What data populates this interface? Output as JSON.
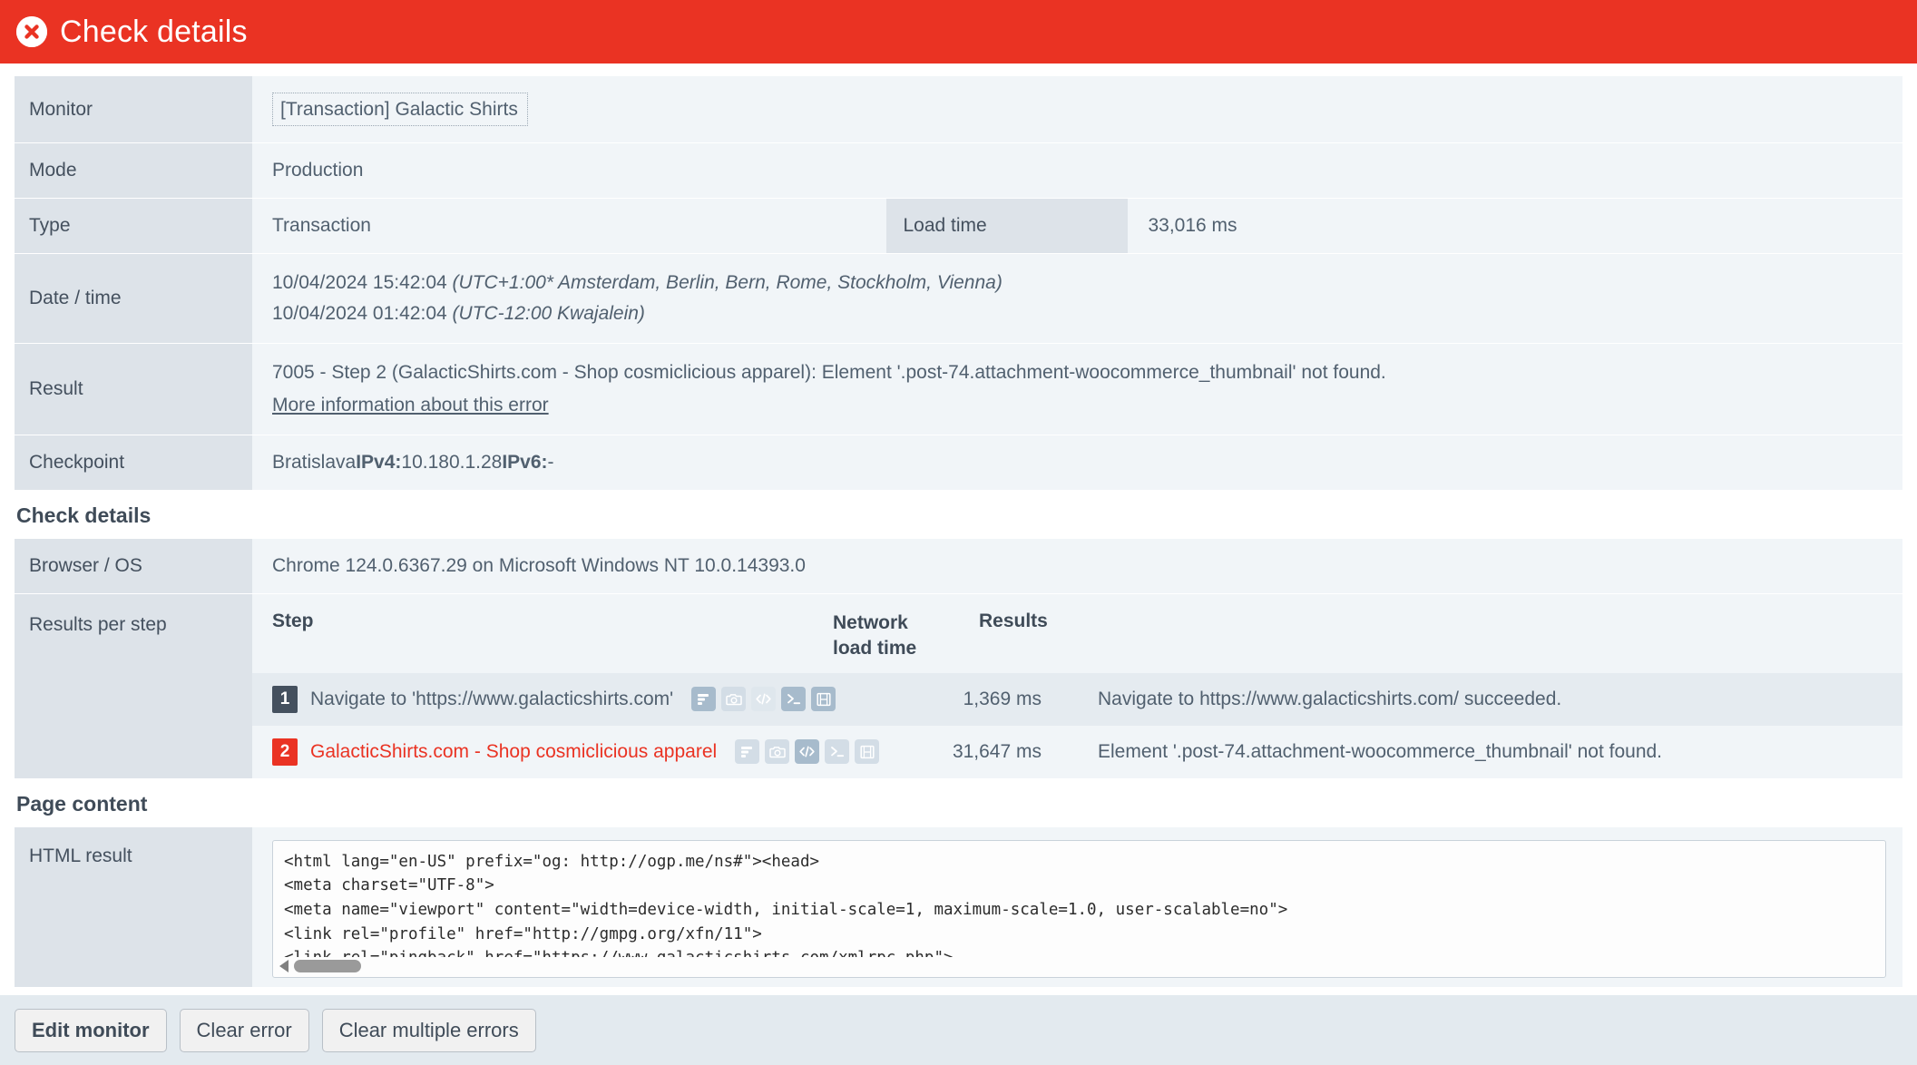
{
  "header": {
    "title": "Check details",
    "icon": "error-circle-x-icon",
    "bg_color": "#ea3323"
  },
  "details": {
    "monitor": {
      "label": "Monitor",
      "value": "[Transaction] Galactic Shirts"
    },
    "mode": {
      "label": "Mode",
      "value": "Production"
    },
    "type": {
      "label": "Type",
      "value": "Transaction"
    },
    "load_time": {
      "label": "Load time",
      "value": "33,016 ms"
    },
    "datetime": {
      "label": "Date / time",
      "line1_date": "10/04/2024 15:42:04 ",
      "line1_tz": "(UTC+1:00* Amsterdam, Berlin, Bern, Rome, Stockholm, Vienna)",
      "line2_date": "10/04/2024 01:42:04 ",
      "line2_tz": "(UTC-12:00 Kwajalein)"
    },
    "result": {
      "label": "Result",
      "message": "7005 - Step 2 (GalacticShirts.com - Shop cosmiclicious apparel): Element '.post-74.attachment-woocommerce_thumbnail' not found.",
      "link": "More information about this error"
    },
    "checkpoint": {
      "label": "Checkpoint",
      "city": "Bratislava ",
      "ipv4_label": "IPv4:",
      "ipv4": " 10.180.1.28 ",
      "ipv6_label": "IPv6:",
      "ipv6": " -"
    }
  },
  "check_details": {
    "heading": "Check details",
    "browser_os": {
      "label": "Browser / OS",
      "value": "Chrome 124.0.6367.29 on Microsoft Windows NT 10.0.14393.0"
    },
    "results_per_step": {
      "label": "Results per step",
      "columns": {
        "step": "Step",
        "network_load_time_l1": "Network",
        "network_load_time_l2": "load time",
        "results": "Results"
      },
      "rows": [
        {
          "number": "1",
          "state": "ok",
          "text": "Navigate to 'https://www.galacticshirts.com'",
          "network_load_time": "1,369 ms",
          "result": "Navigate to https://www.galacticshirts.com/ succeeded.",
          "icons": [
            "waterfall-icon",
            "camera-icon",
            "code-icon",
            "console-icon",
            "filmstrip-icon"
          ]
        },
        {
          "number": "2",
          "state": "error",
          "text": "GalacticShirts.com - Shop cosmiclicious apparel",
          "network_load_time": "31,647 ms",
          "result": "Element '.post-74.attachment-woocommerce_thumbnail' not found.",
          "icons": [
            "waterfall-icon",
            "camera-icon",
            "code-icon",
            "console-icon",
            "filmstrip-icon"
          ]
        }
      ]
    }
  },
  "page_content": {
    "heading": "Page content",
    "html_result": {
      "label": "HTML result",
      "code": "<html lang=\"en-US\" prefix=\"og: http://ogp.me/ns#\"><head>\n<meta charset=\"UTF-8\">\n<meta name=\"viewport\" content=\"width=device-width, initial-scale=1, maximum-scale=1.0, user-scalable=no\">\n<link rel=\"profile\" href=\"http://gmpg.org/xfn/11\">\n<link rel=\"pingback\" href=\"https://www.galacticshirts.com/xmlrpc.php\">"
    }
  },
  "footer": {
    "edit_monitor": "Edit monitor",
    "clear_error": "Clear error",
    "clear_multiple_errors": "Clear multiple errors"
  },
  "colors": {
    "error": "#ea3323",
    "label_bg": "#dde3e9",
    "value_bg": "#f1f5f8",
    "text": "#51606f"
  }
}
